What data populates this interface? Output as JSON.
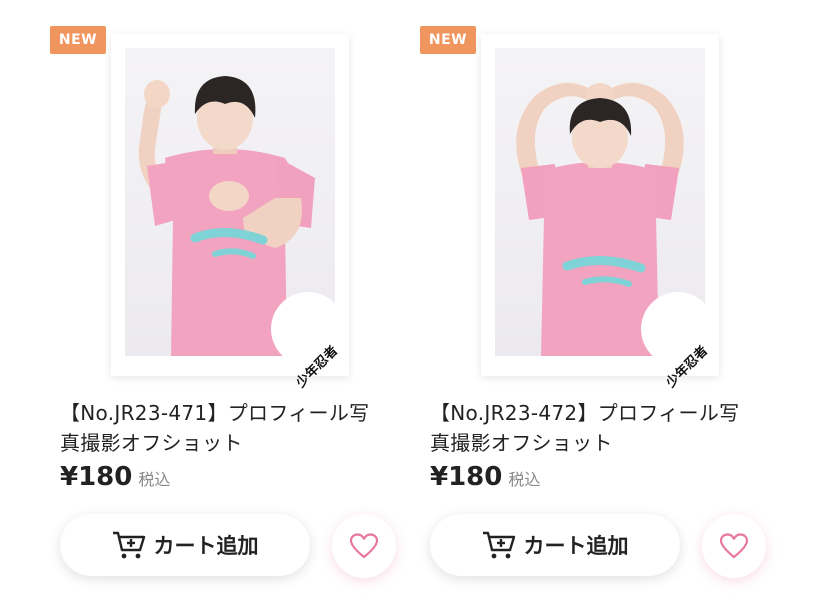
{
  "products": [
    {
      "badge": "NEW",
      "title_line1": "【No.JR23-471】プロフィール写",
      "title_line2": "真撮影オフショット",
      "price": "¥180",
      "tax_label": "税込",
      "cart_label": "カート追加",
      "stamp": "少年忍者",
      "shirt_color": "#f2a3c0",
      "shirt_text_color": "#7fd3d6"
    },
    {
      "badge": "NEW",
      "title_line1": "【No.JR23-472】プロフィール写",
      "title_line2": "真撮影オフショット",
      "price": "¥180",
      "tax_label": "税込",
      "cart_label": "カート追加",
      "stamp": "少年忍者",
      "shirt_color": "#f2a3c0",
      "shirt_text_color": "#7fd3d6"
    }
  ],
  "colors": {
    "badge": "#f0955e",
    "heart": "#e8789a"
  }
}
